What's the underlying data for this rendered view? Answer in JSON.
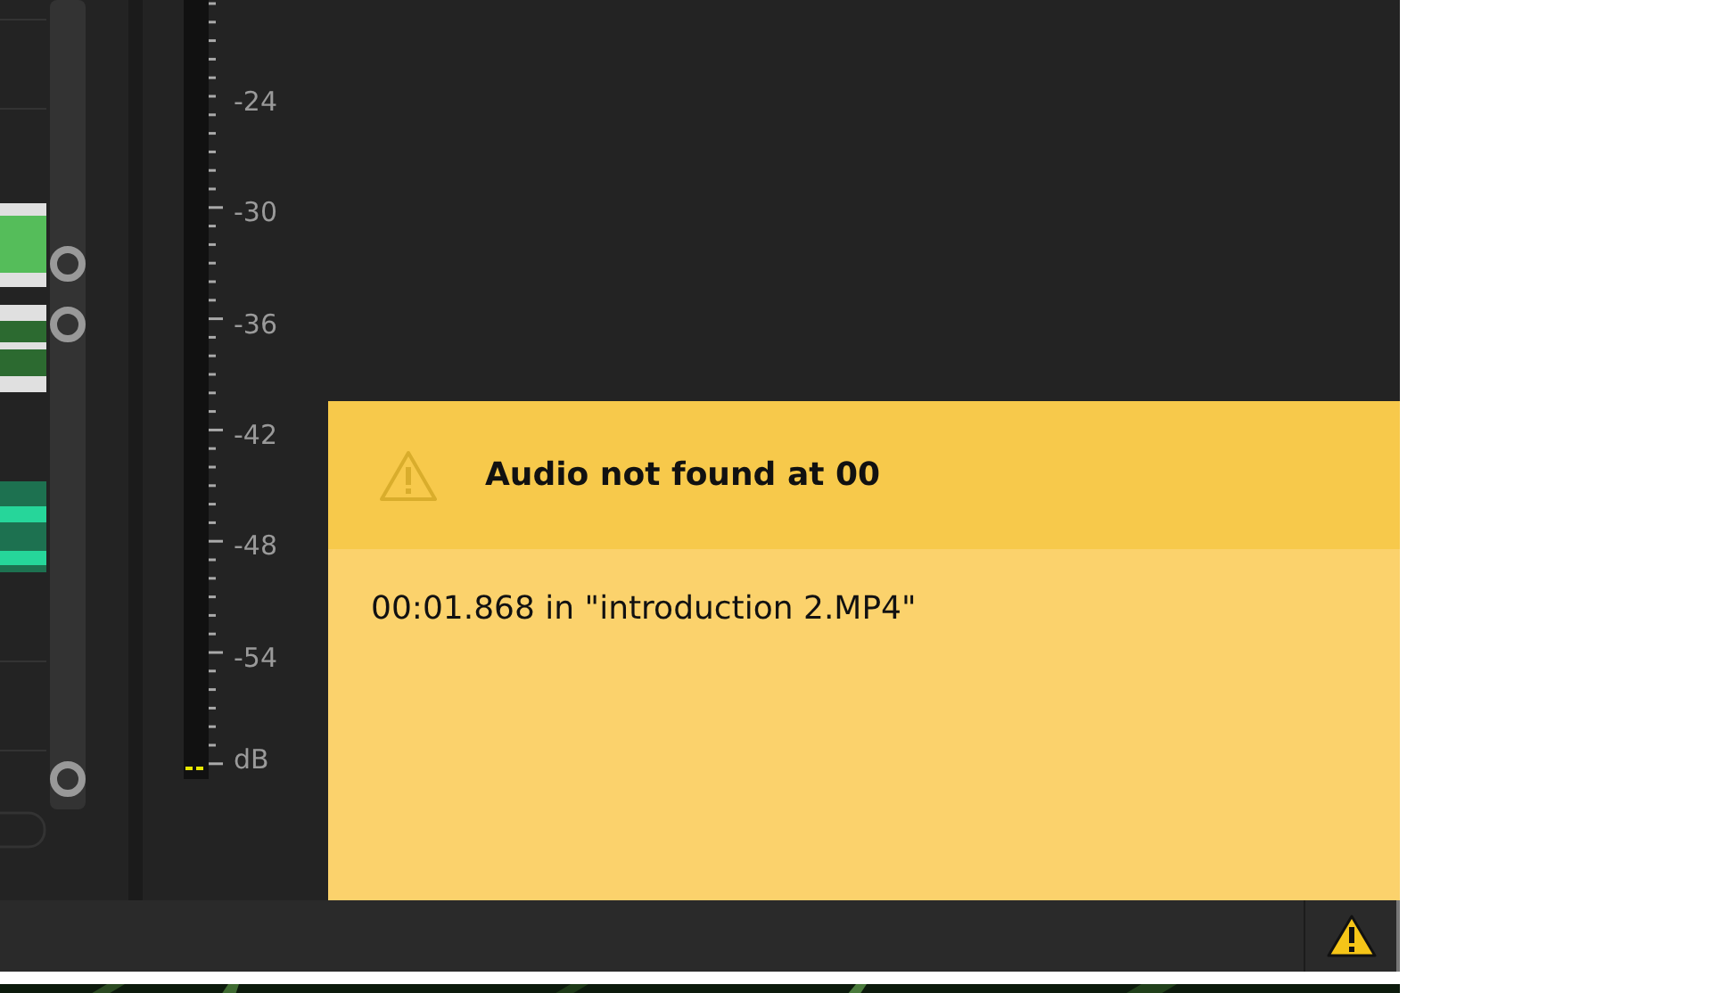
{
  "meter": {
    "scale_labels": [
      "-24",
      "-30",
      "-36",
      "-42",
      "-48",
      "-54",
      "dB"
    ]
  },
  "notice": {
    "title": "Audio not found at 00",
    "message": "00:01.868 in \"introduction 2.MP4\""
  }
}
